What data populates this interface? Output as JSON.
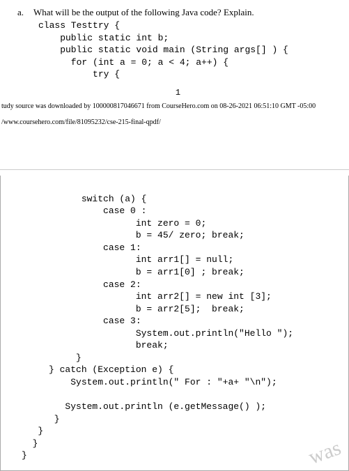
{
  "question": {
    "label": "a.",
    "text": "What will be the output of the following Java code? Explain."
  },
  "code_top": "class Testtry {\n    public static int b;\n    public static void main (String args[] ) {\n      for (int a = 0; a < 4; a++) {\n          try {",
  "page_number": "1",
  "download_note": "tudy source was downloaded by 100000817046671 from CourseHero.com on 08-26-2021 06:51:10 GMT -05:00",
  "url": "/www.coursehero.com/file/81095232/cse-215-final-qpdf/",
  "code_bottom": "           switch (a) {\n               case 0 :\n                     int zero = 0;\n                     b = 45/ zero; break;\n               case 1:\n                     int arr1[] = null;\n                     b = arr1[0] ; break;\n               case 2:\n                     int arr2[] = new int [3];\n                     b = arr2[5];  break;\n               case 3:\n                     System.out.println(\"Hello \");\n                     break;\n          }\n     } catch (Exception e) {\n         System.out.println(\" For : \"+a+ \"\\n\");\n\n        System.out.println (e.getMessage() );\n      }\n   }\n  }\n}",
  "watermark": "was"
}
